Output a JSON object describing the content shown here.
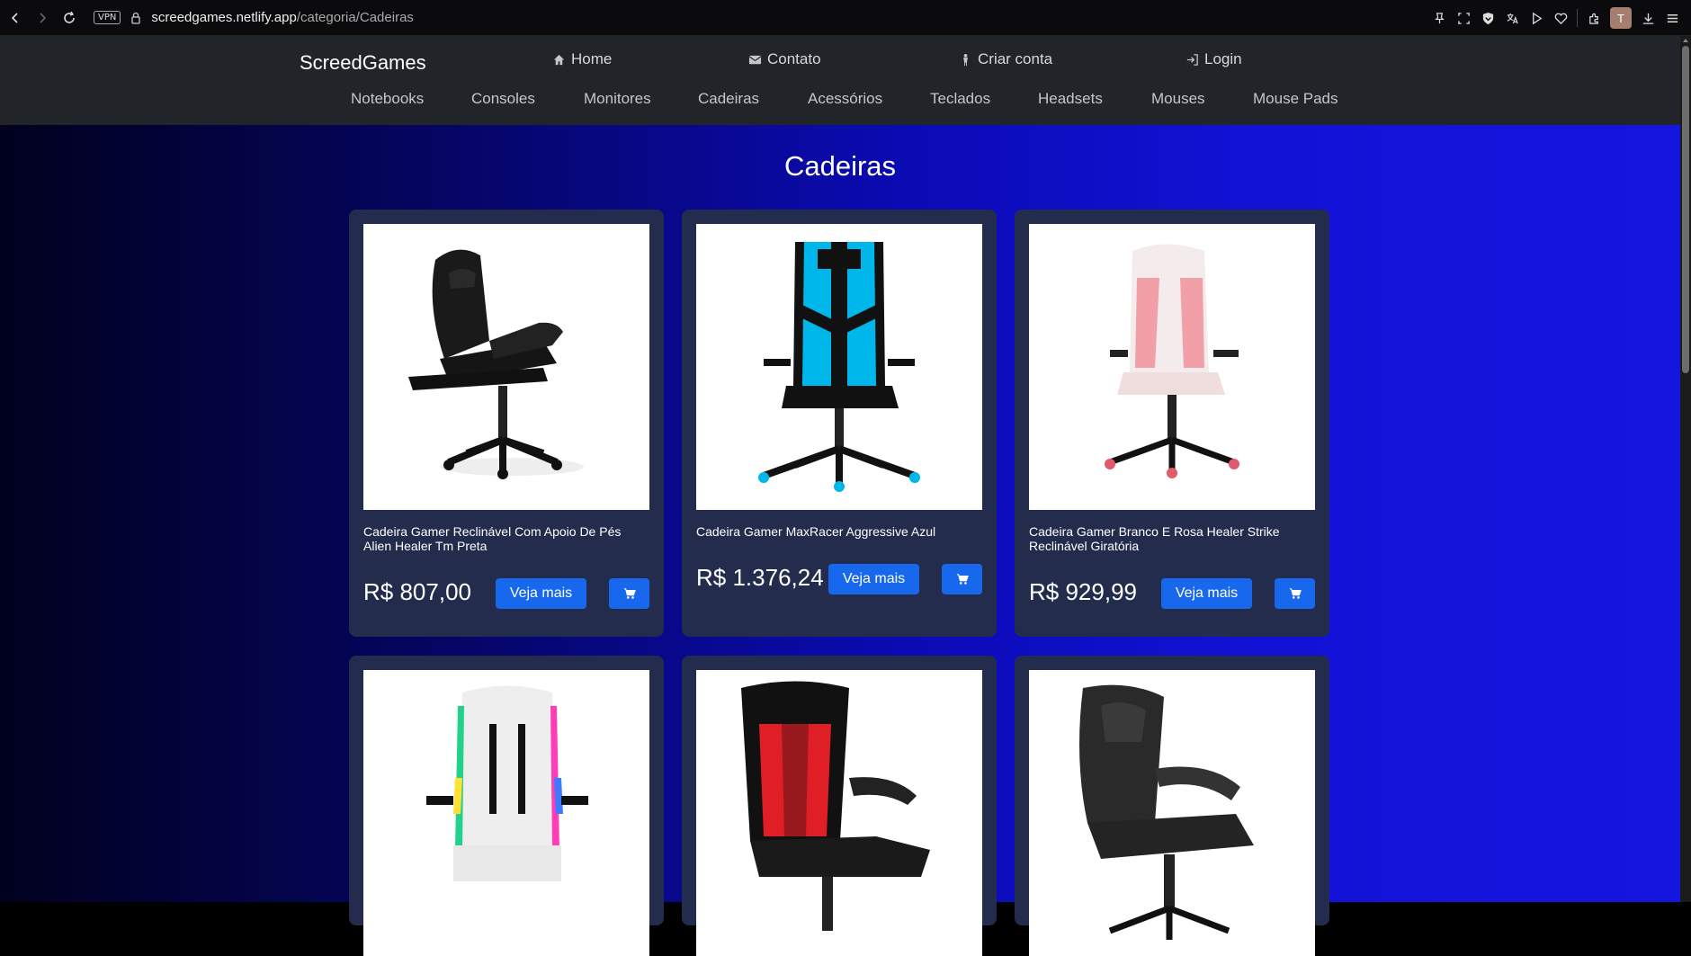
{
  "browser": {
    "vpn_label": "VPN",
    "url_host": "screedgames.netlify.app",
    "url_path": "/categoria/Cadeiras",
    "avatar_letter": "T"
  },
  "site": {
    "brand": "ScreedGames",
    "top_nav": [
      {
        "label": "Home",
        "icon": "house-icon"
      },
      {
        "label": "Contato",
        "icon": "envelope-icon"
      },
      {
        "label": "Criar conta",
        "icon": "person-icon"
      },
      {
        "label": "Login",
        "icon": "login-icon"
      }
    ],
    "categories": [
      "Notebooks",
      "Consoles",
      "Monitores",
      "Cadeiras",
      "Acessórios",
      "Teclados",
      "Headsets",
      "Mouses",
      "Mouse Pads"
    ]
  },
  "page": {
    "title": "Cadeiras"
  },
  "products": [
    {
      "name": "Cadeira Gamer Reclinável Com Apoio De Pés Alien Healer Tm Preta",
      "price": "R$ 807,00",
      "more_label": "Veja mais",
      "image": "black-reclining-chair"
    },
    {
      "name": "Cadeira Gamer MaxRacer Aggressive Azul",
      "price": "R$ 1.376,24",
      "more_label": "Veja mais",
      "image": "blue-black-racer-chair"
    },
    {
      "name": "Cadeira Gamer Branco E Rosa Healer Strike Reclinável Giratória",
      "price": "R$ 929,99",
      "more_label": "Veja mais",
      "image": "white-pink-chair"
    },
    {
      "name": "",
      "price": "",
      "more_label": "",
      "image": "white-rgb-chair"
    },
    {
      "name": "",
      "price": "",
      "more_label": "",
      "image": "red-black-chair"
    },
    {
      "name": "",
      "price": "",
      "more_label": "",
      "image": "black-office-chair"
    }
  ],
  "colors": {
    "header_bg": "#212529",
    "card_bg": "#232c4c",
    "button_blue": "#1868ee",
    "gradient_dark": "#01011e",
    "gradient_bright": "#1515e0"
  }
}
